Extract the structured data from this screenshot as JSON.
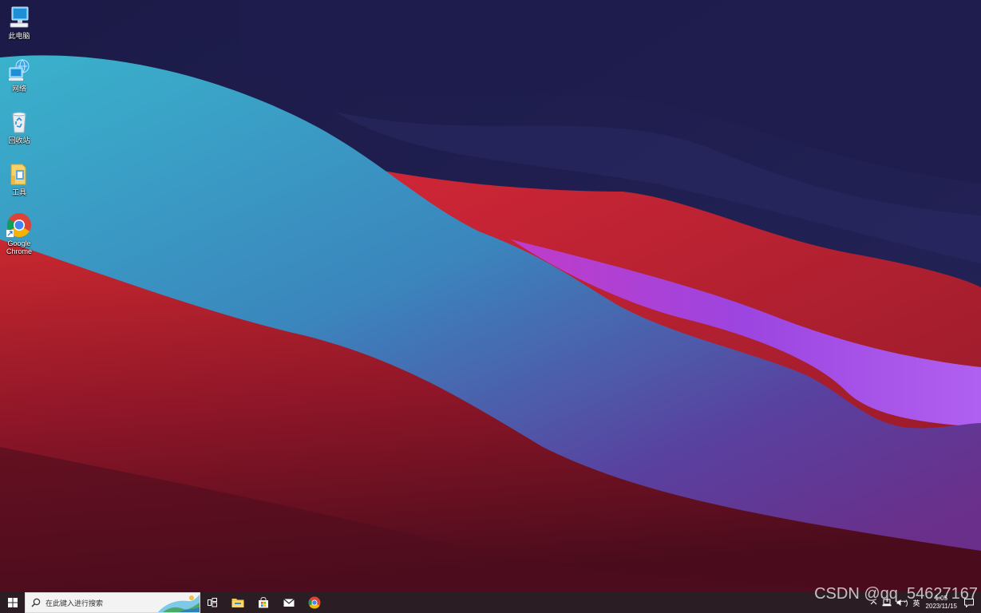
{
  "desktop": {
    "icons": [
      {
        "label": "此电脑"
      },
      {
        "label": "网络"
      },
      {
        "label": "回收站"
      },
      {
        "label": "工具"
      },
      {
        "label": "Google Chrome"
      }
    ]
  },
  "taskbar": {
    "search": {
      "placeholder": "在此键入进行搜索"
    },
    "tray": {
      "volume_label": "ᐧ)",
      "ime_label": "英",
      "time": "1:05",
      "date": "2023/11/15"
    }
  },
  "watermark": "CSDN @qq_54627167",
  "colors": {
    "taskbar_bg": "#2b1d24",
    "search_bg": "#f3f3f3",
    "wallpaper_navy": "#1d1b44",
    "wallpaper_teal": "#3aa0c4",
    "wallpaper_red": "#c8242e",
    "wallpaper_purple": "#a04ee0"
  }
}
